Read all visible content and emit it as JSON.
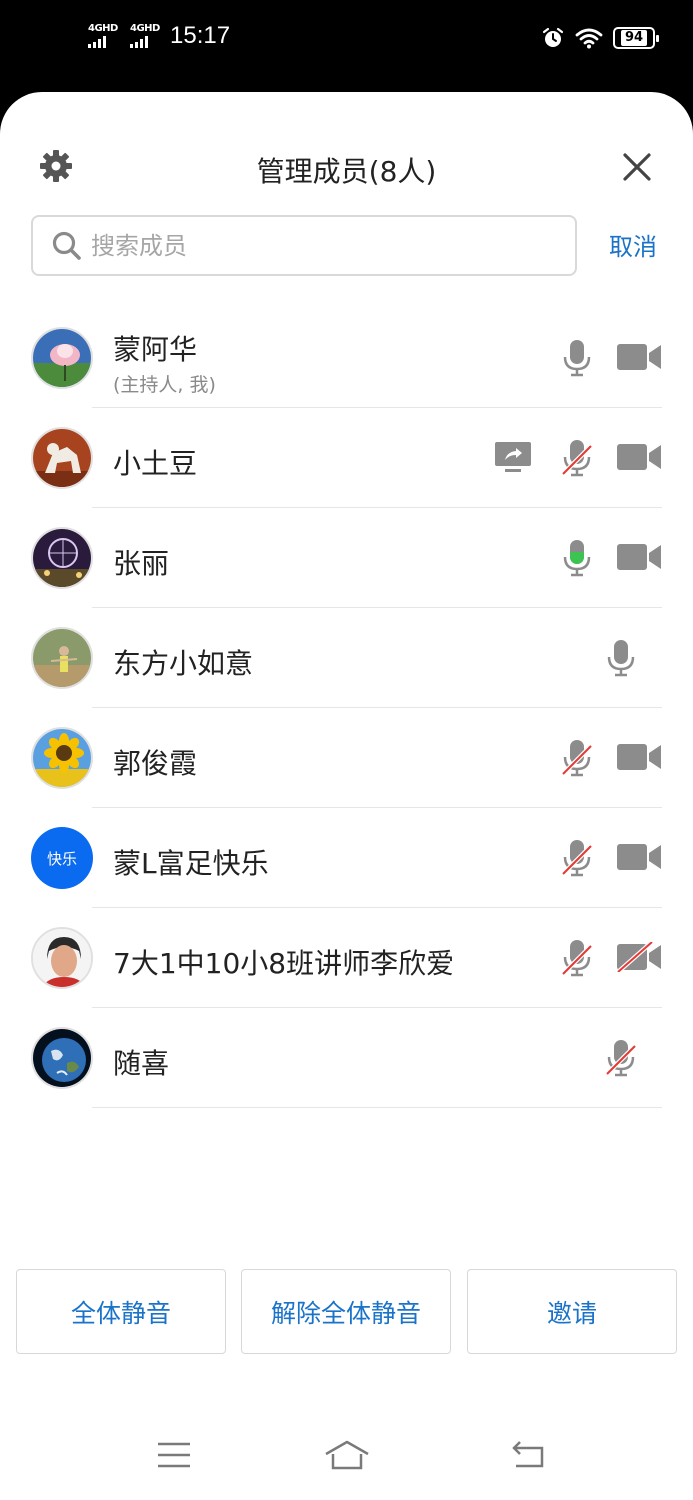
{
  "status_bar": {
    "network_1": "4GHD",
    "network_2": "4GHD",
    "time": "15:17",
    "battery": "94",
    "icons": [
      "alarm-clock-icon",
      "wifi-icon",
      "battery-icon"
    ]
  },
  "header": {
    "title": "管理成员(8人)",
    "icons": [
      "gear-icon",
      "close-icon"
    ]
  },
  "search": {
    "placeholder": "搜索成员",
    "value": "",
    "cancel_label": "取消"
  },
  "members": [
    {
      "name": "蒙阿华",
      "role": "(主持人, 我)",
      "screen_share": false,
      "mic": "on",
      "camera": "on"
    },
    {
      "name": "小土豆",
      "role": "",
      "screen_share": true,
      "mic": "muted",
      "camera": "on"
    },
    {
      "name": "张丽",
      "role": "",
      "screen_share": false,
      "mic": "speaking",
      "camera": "on"
    },
    {
      "name": "东方小如意",
      "role": "",
      "screen_share": false,
      "mic": "on",
      "camera": "none"
    },
    {
      "name": "郭俊霞",
      "role": "",
      "screen_share": false,
      "mic": "muted",
      "camera": "on"
    },
    {
      "name": "蒙L富足快乐",
      "avatar_text": "快乐",
      "role": "",
      "screen_share": false,
      "mic": "muted",
      "camera": "on"
    },
    {
      "name": "7大1中10小8班讲师李欣爱",
      "role": "",
      "screen_share": false,
      "mic": "muted",
      "camera": "off"
    },
    {
      "name": "随喜",
      "role": "",
      "screen_share": false,
      "mic": "muted",
      "camera": "none"
    }
  ],
  "actions": {
    "mute_all": "全体静音",
    "unmute_all": "解除全体静音",
    "invite": "邀请"
  },
  "colors": {
    "accent": "#1a73c9",
    "icon_gray": "#8c8c8c",
    "speaking_green": "#3cc351",
    "muted_red": "#e53935",
    "avatar_blue": "#0a6bf0"
  },
  "nav_bar": [
    "menu-icon",
    "home-icon",
    "back-icon"
  ]
}
